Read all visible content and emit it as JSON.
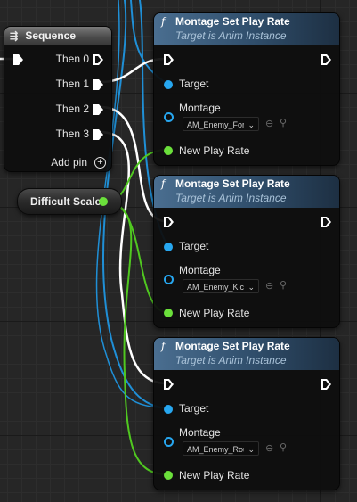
{
  "sequence": {
    "title": "Sequence",
    "outputs": [
      "Then 0",
      "Then 1",
      "Then 2",
      "Then 3"
    ],
    "add_pin": "Add pin"
  },
  "variable": {
    "label": "Difficult Scale"
  },
  "function_nodes": [
    {
      "title": "Montage Set Play Rate",
      "subtitle": "Target is Anim Instance",
      "target_label": "Target",
      "montage_label": "Montage",
      "montage_value": "AM_Enemy_Forw",
      "rate_label": "New Play Rate"
    },
    {
      "title": "Montage Set Play Rate",
      "subtitle": "Target is Anim Instance",
      "target_label": "Target",
      "montage_label": "Montage",
      "montage_value": "AM_Enemy_Kick",
      "rate_label": "New Play Rate"
    },
    {
      "title": "Montage Set Play Rate",
      "subtitle": "Target is Anim Instance",
      "target_label": "Target",
      "montage_label": "Montage",
      "montage_value": "AM_Enemy_Rou",
      "rate_label": "New Play Rate"
    }
  ],
  "colors": {
    "exec": "#ffffff",
    "object_pin": "#27a7f0",
    "float_pin": "#6be03b",
    "function_header": "#2f4d6a"
  },
  "icons": {
    "function": "f",
    "sequence": "sequence-icon",
    "dropdown": "chevron-down-icon",
    "browse": "arrow-left-icon",
    "find": "search-icon"
  }
}
